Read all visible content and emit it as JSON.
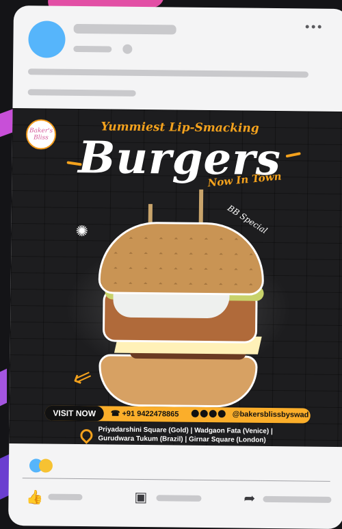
{
  "post": {
    "logo_text": "Baker's Bliss",
    "tagline": "Yummiest Lip-Smacking",
    "headline": "Burgers",
    "subline": "Now In Town",
    "badge": "BB Special"
  },
  "contact": {
    "cta": "VISIT NOW",
    "phone": "+91 9422478865",
    "handle": "@bakersblissbyswad",
    "address_line1": "Priyadarshini Square (Gold) | Wadgaon Fata (Venice) |",
    "address_line2": "Gurudwara Tukum (Brazil) | Girnar Square (London)"
  },
  "colors": {
    "accent": "#f4a21d",
    "avatar": "#56b5fb",
    "card": "#f4f4f5",
    "background": "#141417"
  },
  "icons": [
    "more-options-icon",
    "location-pin-icon",
    "facebook-icon",
    "instagram-icon",
    "twitter-icon",
    "youtube-icon",
    "like-icon",
    "comment-icon",
    "share-icon"
  ]
}
